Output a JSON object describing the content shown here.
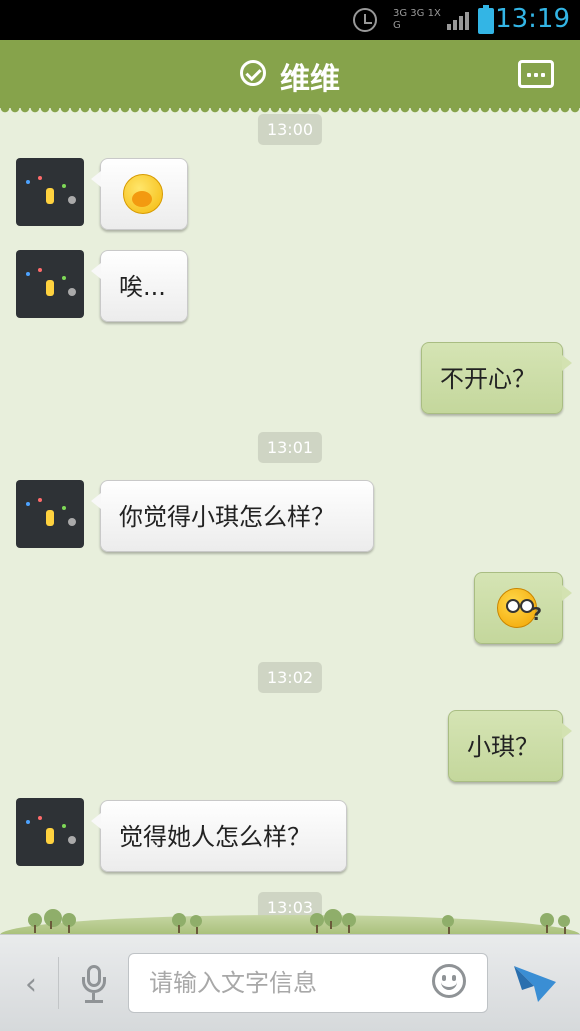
{
  "status_bar": {
    "time": "13:19",
    "network_label": "3G 3G 1X G",
    "icons": [
      "alarm-icon",
      "network-icon",
      "signal-icon",
      "battery-icon"
    ]
  },
  "header": {
    "title": "维维",
    "status_icon": "check-circle-icon",
    "menu_icon": "more-dots-icon",
    "accent_color": "#86a34b"
  },
  "messages": [
    {
      "type": "time",
      "text": "13:00"
    },
    {
      "type": "left",
      "emoji": "shy-emoji"
    },
    {
      "type": "left",
      "text": "唉..."
    },
    {
      "type": "right",
      "text": "不开心？"
    },
    {
      "type": "time",
      "text": "13:01"
    },
    {
      "type": "left",
      "text": "你觉得小琪怎么样？"
    },
    {
      "type": "right",
      "emoji": "confused-emoji"
    },
    {
      "type": "time",
      "text": "13:02"
    },
    {
      "type": "right",
      "text": "小琪？"
    },
    {
      "type": "left",
      "text": "觉得她人怎么样？"
    },
    {
      "type": "time",
      "text": "13:03"
    }
  ],
  "input_bar": {
    "back_icon": "chevron-left-icon",
    "mic_icon": "microphone-icon",
    "placeholder": "请输入文字信息",
    "emoji_icon": "smiley-icon",
    "send_icon": "paper-plane-icon",
    "send_color": "#3a8ed4"
  }
}
